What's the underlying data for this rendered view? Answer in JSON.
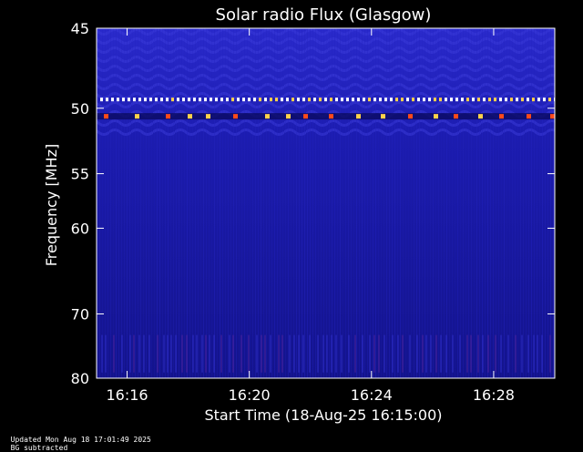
{
  "chart_data": {
    "type": "heatmap",
    "title": "Solar radio Flux (Glasgow)",
    "xlabel": "Start Time (18-Aug-25 16:15:00)",
    "ylabel": "Frequency [MHz]",
    "x_ticks": [
      "16:16",
      "16:20",
      "16:24",
      "16:28"
    ],
    "x_tick_minutes_after_start": [
      1,
      5,
      9,
      13
    ],
    "x_range_minutes_after_start": [
      0,
      15
    ],
    "y_ticks": [
      45,
      50,
      55,
      60,
      70,
      80
    ],
    "y_range": [
      45,
      80
    ],
    "y_scale": "reciprocal",
    "colors": {
      "background": "#000000",
      "plot_base": "#1a1aa0",
      "band_bright": "#ffd24a",
      "band_hot": "#ff4a1a",
      "interference": "#ffffff"
    },
    "features": [
      {
        "label": "persistent emission lines",
        "frequency_mhz": [
          49.4,
          50.6
        ]
      },
      {
        "label": "interference striping",
        "frequency_mhz": [
          73,
          79
        ]
      }
    ]
  },
  "footer": {
    "updated": "Updated Mon Aug 18 17:01:49 2025",
    "note": "BG subtracted"
  }
}
